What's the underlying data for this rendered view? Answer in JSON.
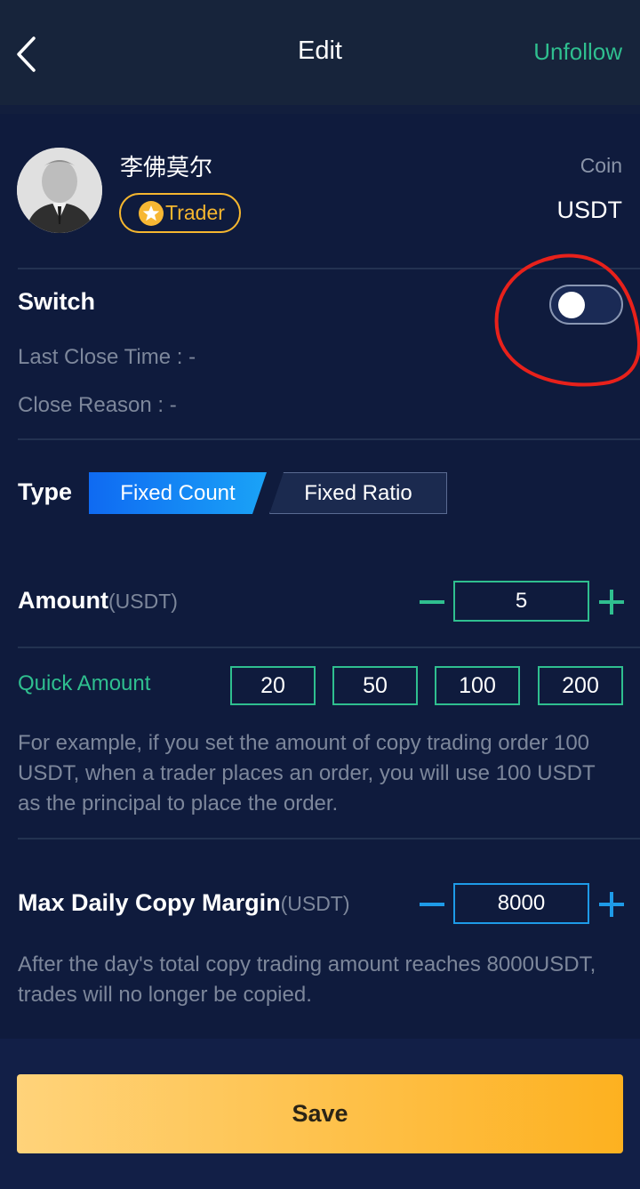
{
  "header": {
    "title": "Edit",
    "unfollow_label": "Unfollow"
  },
  "trader": {
    "name": "李佛莫尔",
    "badge_label": "Trader"
  },
  "coin": {
    "label": "Coin",
    "value": "USDT"
  },
  "switch": {
    "label": "Switch",
    "enabled": false,
    "last_close_time": "Last Close Time : -",
    "close_reason": "Close Reason : -"
  },
  "type": {
    "label": "Type",
    "options": [
      "Fixed Count",
      "Fixed Ratio"
    ],
    "selected": "Fixed Count"
  },
  "amount": {
    "label": "Amount",
    "unit": "(USDT)",
    "value": "5"
  },
  "quick_amount": {
    "label": "Quick Amount",
    "options": [
      "20",
      "50",
      "100",
      "200"
    ]
  },
  "amount_help": "For example, if you set the amount of copy trading order 100 USDT, when a trader places an order, you will use 100 USDT as the principal to place the order.",
  "max_margin": {
    "label": "Max Daily Copy Margin",
    "unit": "(USDT)",
    "value": "8000"
  },
  "max_margin_help": "After the day's total copy trading amount reaches 8000USDT, trades will no longer be copied.",
  "save_label": "Save",
  "colors": {
    "accent_green": "#2fbf8f",
    "accent_blue": "#1e9be8",
    "gold": "#f5b62f",
    "background": "#0f1b3d"
  }
}
